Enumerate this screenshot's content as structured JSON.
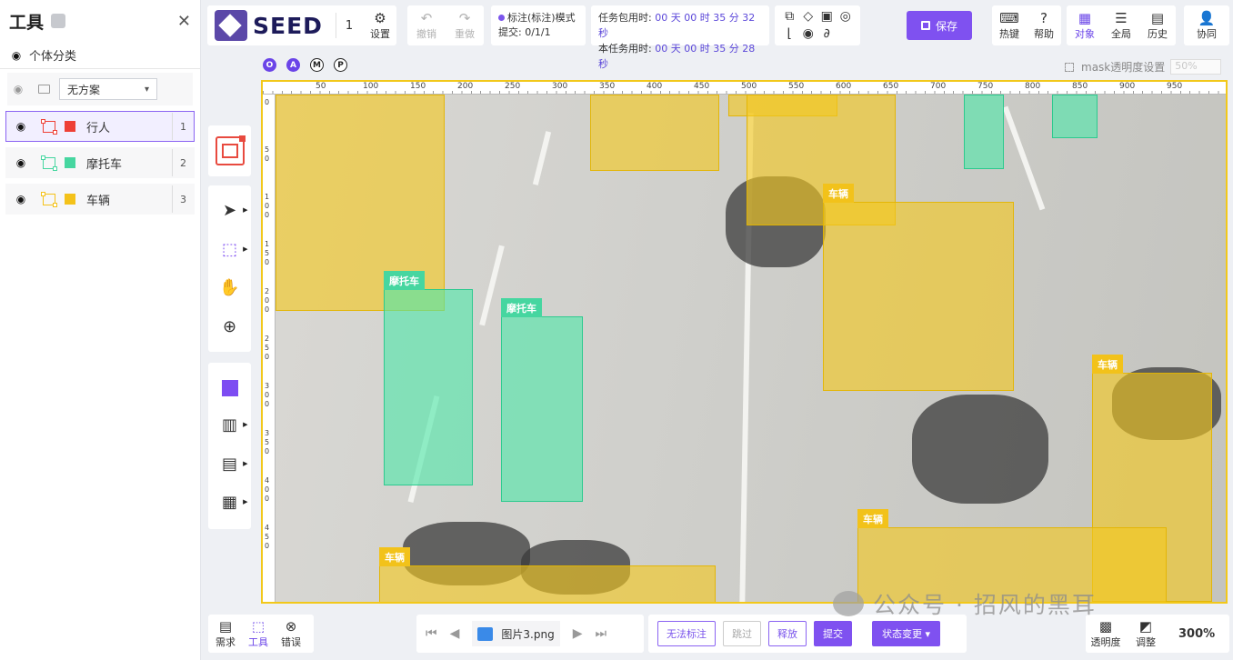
{
  "left_panel": {
    "title": "工具",
    "close_icon": "close-icon",
    "section": "个体分类",
    "scheme": "无方案",
    "classes": [
      {
        "name": "行人",
        "index": "1",
        "color": "#ee4036"
      },
      {
        "name": "摩托车",
        "index": "2",
        "color": "#46d6a0"
      },
      {
        "name": "车辆",
        "index": "3",
        "color": "#f4c21a"
      }
    ]
  },
  "toolbar": {
    "brand": "SEED",
    "task_number": "1",
    "settings": "设置",
    "undo": "撤销",
    "redo": "重做",
    "mode": "标注(标注)模式",
    "submit_progress": "提交: 0/1/1",
    "task_pkg_time_label": "任务包用时:",
    "task_pkg_time": "00 天 00 时 35 分 32 秒",
    "task_time_label": "本任务用时:",
    "task_time": "00 天 00 时 35 分 28 秒",
    "save": "保存",
    "hotkeys": "热键",
    "help": "帮助",
    "objects": "对象",
    "global": "全局",
    "history": "历史",
    "collab": "协同"
  },
  "canvas": {
    "badges": [
      "O",
      "A",
      "M",
      "P"
    ],
    "mask_label": "mask透明度设置",
    "mask_value": "50%",
    "ruler_h": [
      "50",
      "100",
      "150",
      "200",
      "250",
      "300",
      "350",
      "400",
      "450",
      "500",
      "550",
      "600",
      "650",
      "700",
      "750",
      "800",
      "850",
      "900",
      "950"
    ],
    "ruler_v": [
      "0",
      "50",
      "100",
      "150",
      "200",
      "250",
      "300",
      "350",
      "400",
      "450"
    ],
    "annotations": [
      {
        "label": "车辆",
        "kind": "car"
      },
      {
        "label": "车辆",
        "kind": "car"
      },
      {
        "label": "车辆",
        "kind": "car"
      },
      {
        "label": "车辆",
        "kind": "car"
      },
      {
        "label": "车辆",
        "kind": "car"
      },
      {
        "label": "车辆",
        "kind": "car"
      },
      {
        "label": "车辆",
        "kind": "car"
      },
      {
        "label": "车辆",
        "kind": "car"
      },
      {
        "label": "摩托车",
        "kind": "moto"
      },
      {
        "label": "摩托车",
        "kind": "moto"
      },
      {
        "label": "摩托车",
        "kind": "moto"
      },
      {
        "label": "摩托车",
        "kind": "moto"
      }
    ]
  },
  "watermark": "公众号 · 招风的黑耳",
  "bottom": {
    "requirements": "需求",
    "tools": "工具",
    "errors": "错误",
    "file_name": "图片3.png",
    "btn_unlabelable": "无法标注",
    "btn_skip": "跳过",
    "btn_release": "释放",
    "btn_submit": "提交",
    "btn_state": "状态变更",
    "transparency": "透明度",
    "adjust": "调整",
    "zoom": "300%"
  }
}
